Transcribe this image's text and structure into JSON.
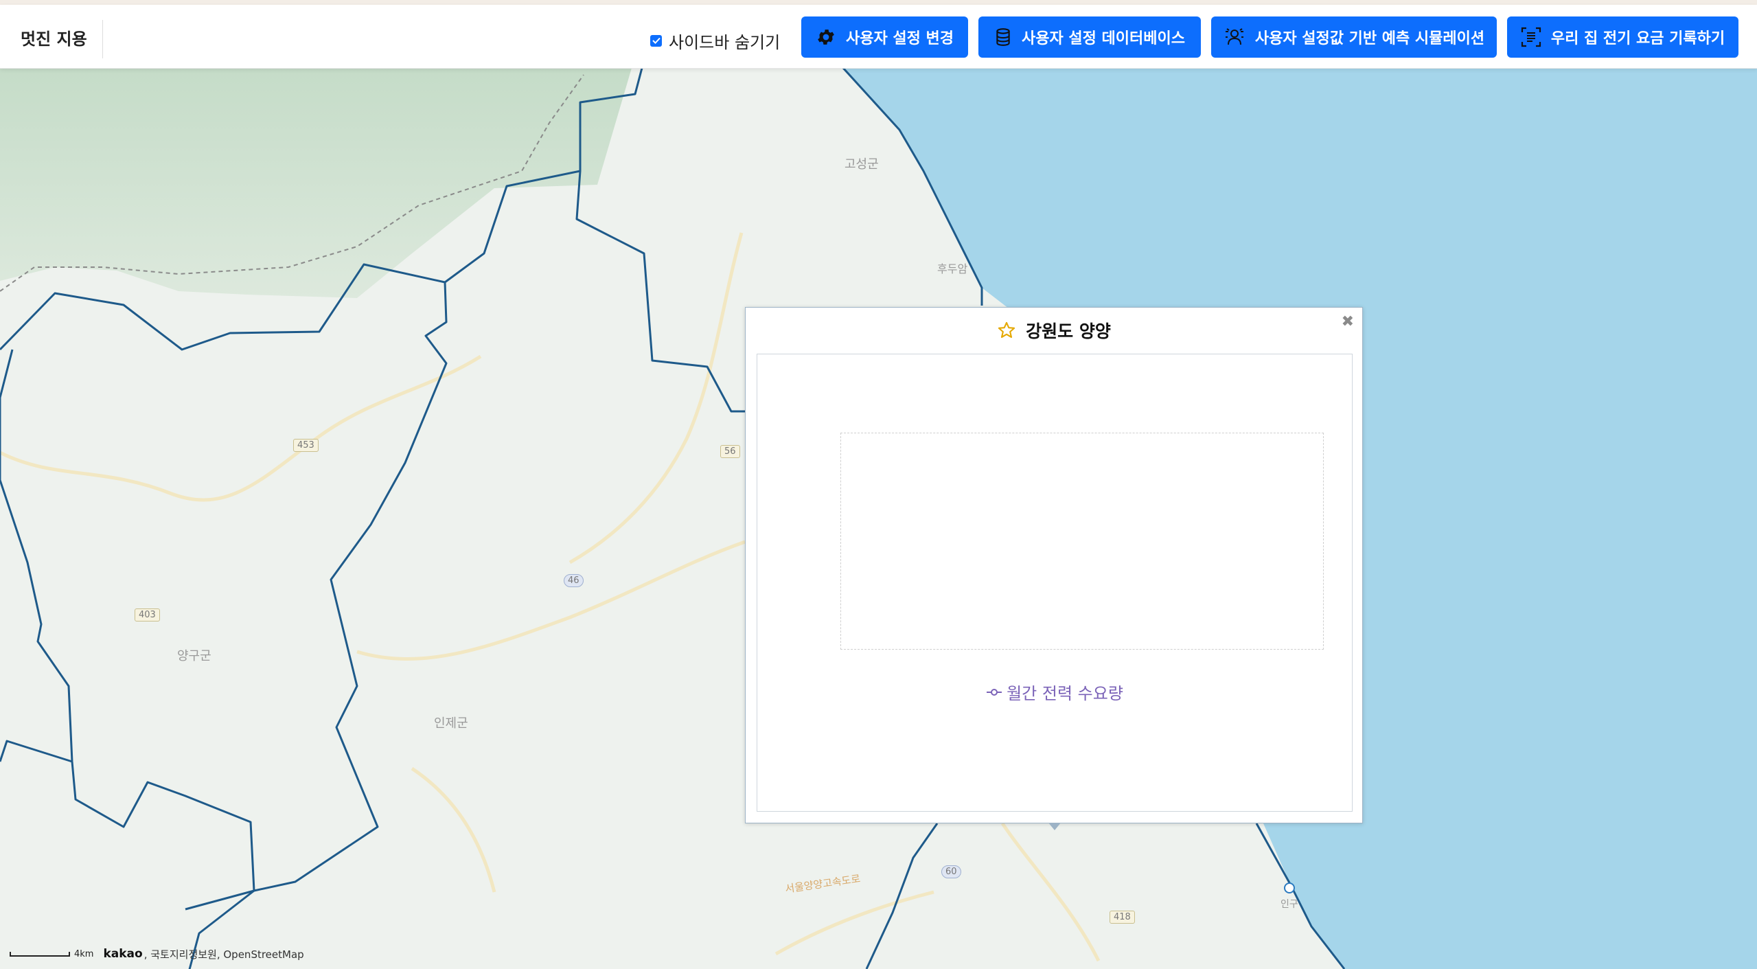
{
  "navbar": {
    "brand": "멋진 지용",
    "sidebar_toggle_label": "사이드바 숨기기",
    "sidebar_toggle_checked": true,
    "buttons": [
      {
        "label": "사용자 설정 변경",
        "icon": "gear-icon"
      },
      {
        "label": "사용자 설정 데이터베이스",
        "icon": "database-icon"
      },
      {
        "label": "사용자 설정값 기반 예측 시뮬레이션",
        "icon": "user-scan-icon"
      },
      {
        "label": "우리 집 전기 요금 기록하기",
        "icon": "document-scan-icon"
      }
    ],
    "accent_color": "#0d6efd"
  },
  "map": {
    "labels": {
      "goseong": "고성군",
      "yanggu": "양구군",
      "inje": "인제군",
      "bawi": "후두암",
      "expressway": "서울양양고속도로",
      "port": "인구"
    },
    "route_shields": [
      "453",
      "56",
      "46",
      "403",
      "60",
      "418"
    ],
    "attribution": {
      "scale": "4km",
      "provider": "kakao",
      "sources": ", 국토지리정보원, OpenStreetMap"
    },
    "sea_color": "#a5d5ea",
    "boundary_color": "#1e5a8a"
  },
  "popup": {
    "title": "강원도 양양",
    "title_icon": "star-outline-icon",
    "close_icon": "close-icon",
    "legend_label": "월간 전력 수요량",
    "legend_color": "#7b63b8"
  }
}
